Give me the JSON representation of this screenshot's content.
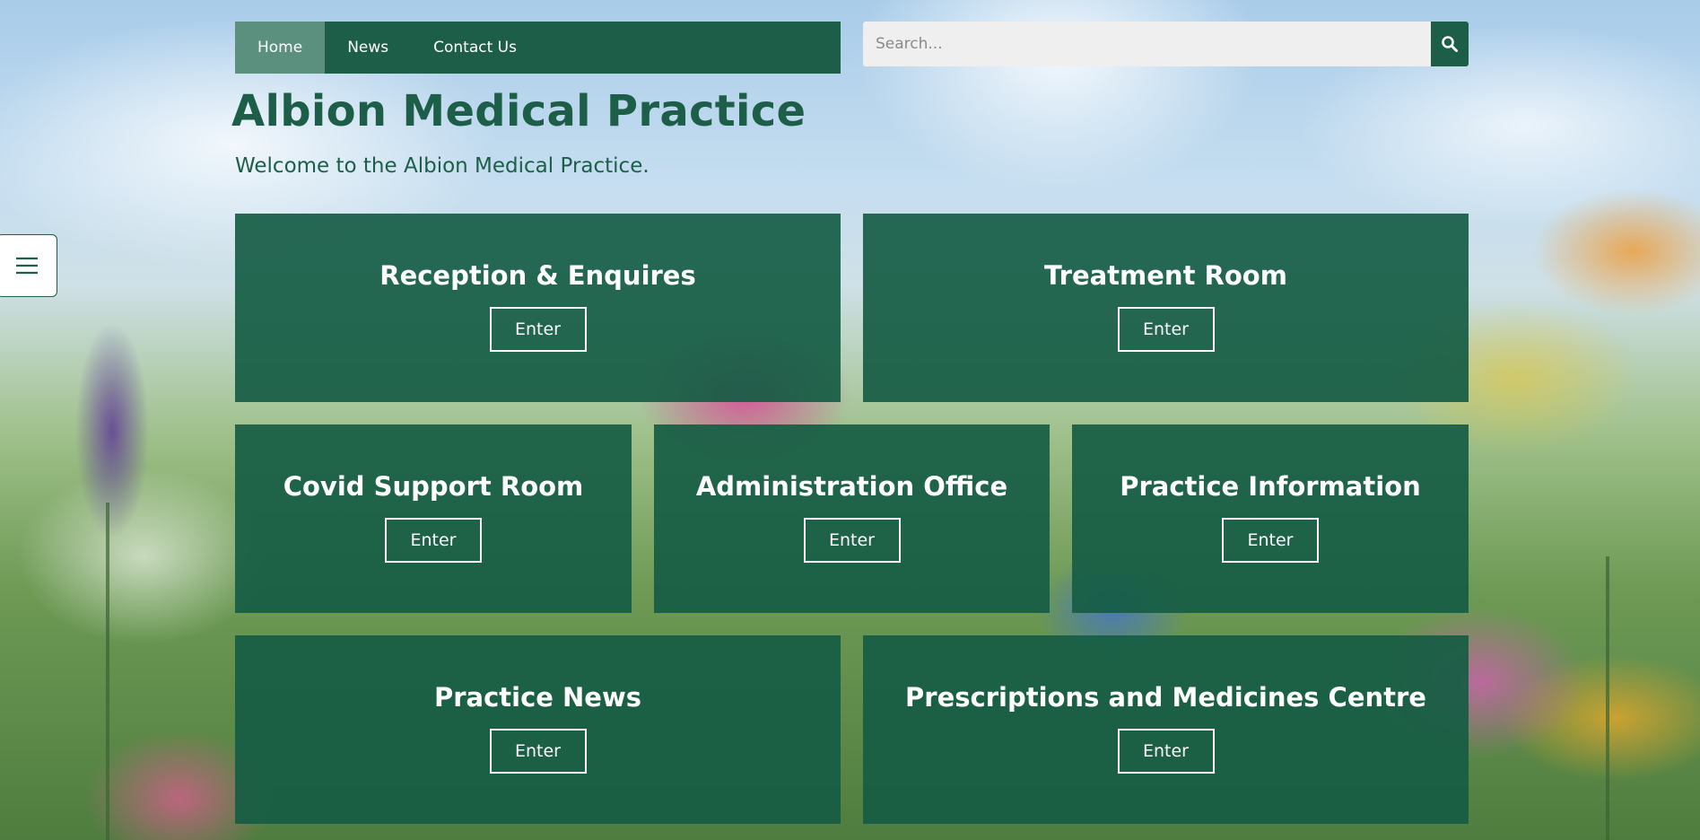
{
  "nav": {
    "items": [
      {
        "label": "Home",
        "active": true
      },
      {
        "label": "News",
        "active": false
      },
      {
        "label": "Contact Us",
        "active": false
      }
    ]
  },
  "search": {
    "placeholder": "Search...",
    "icon": "search-icon"
  },
  "header": {
    "title": "Albion Medical Practice",
    "subtitle": "Welcome to the Albion Medical Practice."
  },
  "menu_toggle": {
    "icon": "hamburger-menu-icon"
  },
  "tiles": [
    {
      "title": "Reception & Enquires",
      "button": "Enter"
    },
    {
      "title": "Treatment Room",
      "button": "Enter"
    },
    {
      "title": "Covid Support Room",
      "button": "Enter"
    },
    {
      "title": "Administration Office",
      "button": "Enter"
    },
    {
      "title": "Practice Information",
      "button": "Enter"
    },
    {
      "title": "Practice News",
      "button": "Enter"
    },
    {
      "title": "Prescriptions and Medicines Centre",
      "button": "Enter"
    }
  ],
  "colors": {
    "brand_green": "#1d5e48",
    "active_nav": "#5a907d",
    "tile_bg": "#165c44"
  }
}
